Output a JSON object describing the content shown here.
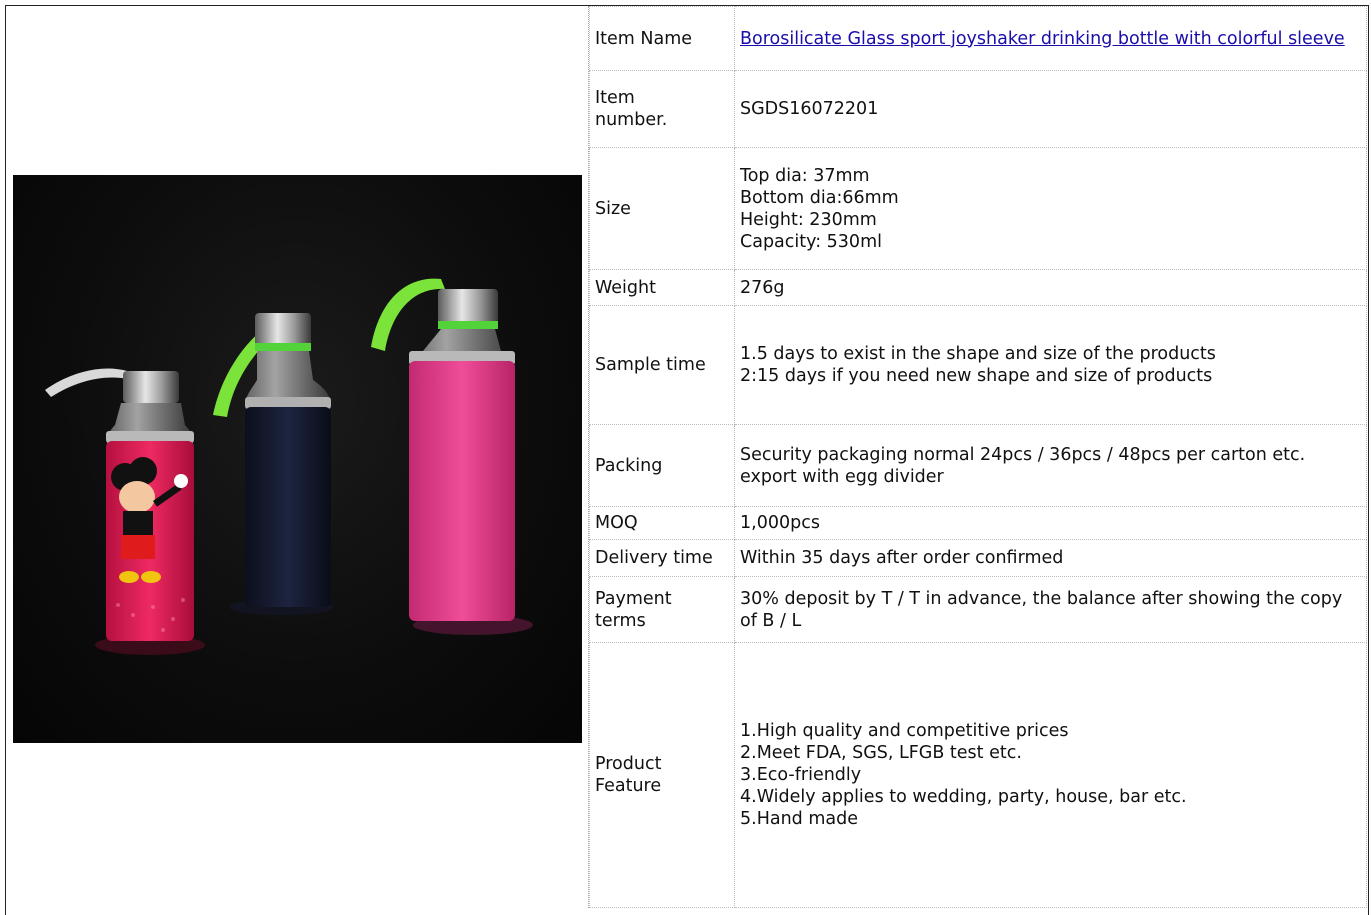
{
  "product_image": {
    "icon": "product-photo",
    "background": "#0b0b0b",
    "bottles": [
      {
        "sleeve_color": "#e5205a",
        "strap_color": "#d9d9d9",
        "print": "mickey-mouse"
      },
      {
        "sleeve_color": "#141a2e",
        "strap_color": "#7be33a"
      },
      {
        "sleeve_color": "#e33f8b",
        "strap_color": "#7be33a"
      }
    ]
  },
  "specs": {
    "item_name": {
      "label": "Item Name",
      "value": "Borosilicate Glass sport joyshaker drinking bottle with colorful sleeve"
    },
    "item_number": {
      "label": "Item\nnumber.",
      "value": "SGDS16072201"
    },
    "size": {
      "label": "Size",
      "value": "Top dia: 37mm\nBottom dia:66mm\nHeight: 230mm\nCapacity: 530ml"
    },
    "weight": {
      "label": "Weight",
      "value": "276g"
    },
    "sample_time": {
      "label": "Sample time",
      "value": "1.5 days to exist in the shape and size of the products\n2:15 days if you need new shape and size of products"
    },
    "packing": {
      "label": "Packing",
      "value": "Security packaging normal 24pcs / 36pcs / 48pcs per carton etc. export with egg divider"
    },
    "moq": {
      "label": "MOQ",
      "value": "1,000pcs"
    },
    "delivery_time": {
      "label": "Delivery time",
      "value": "Within 35 days after order confirmed"
    },
    "payment_terms": {
      "label": "Payment\nterms",
      "value": "30% deposit by T / T in advance, the balance after showing the copy of B / L"
    },
    "product_feature": {
      "label": "Product\nFeature",
      "value": "1.High quality and competitive prices\n2.Meet FDA, SGS, LFGB test etc.\n3.Eco-friendly\n4.Widely applies to wedding, party, house, bar etc.\n5.Hand made"
    }
  },
  "colors": {
    "link": "#1a0dab",
    "border": "#bbbbbb",
    "frame": "#222222"
  }
}
